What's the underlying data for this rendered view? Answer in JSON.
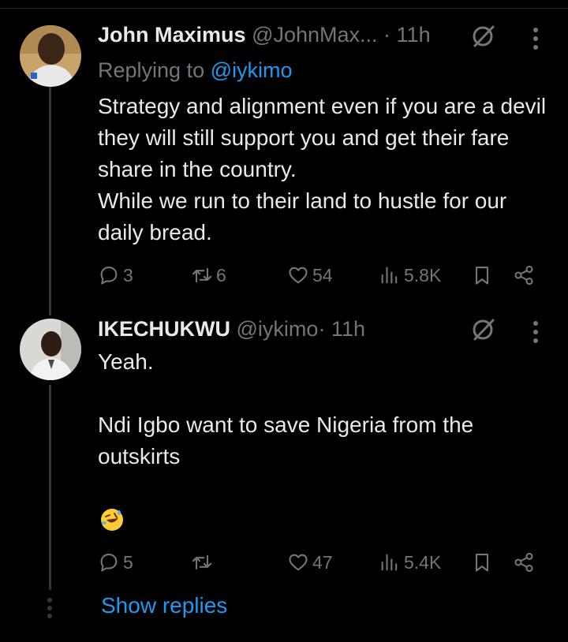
{
  "tweets": [
    {
      "name": "John Maximus",
      "handle": "@JohnMax...",
      "time": "· 11h",
      "replying_label": "Replying to",
      "replying_to": "@iykimo",
      "paragraphs": [
        "Strategy and alignment even if you are a devil they will still support you and get their fare share in the country.",
        "While we run to their land to hustle for our daily bread."
      ],
      "replies": "3",
      "retweets": "6",
      "likes": "54",
      "views": "5.8K"
    },
    {
      "name": "IKECHUKWU",
      "handle": "@iykimo",
      "time": "· 11h",
      "paragraphs": [
        "Yeah.",
        "Ndi Igbo want to save Nigeria from the outskirts"
      ],
      "emoji": "rolling-on-floor-laughing",
      "replies": "5",
      "retweets": "",
      "likes": "47",
      "views": "5.4K"
    }
  ],
  "show_replies": "Show replies",
  "colors": {
    "background": "#000000",
    "text": "#e7e9ea",
    "muted": "#71767b",
    "accent": "#1d9bf0"
  }
}
